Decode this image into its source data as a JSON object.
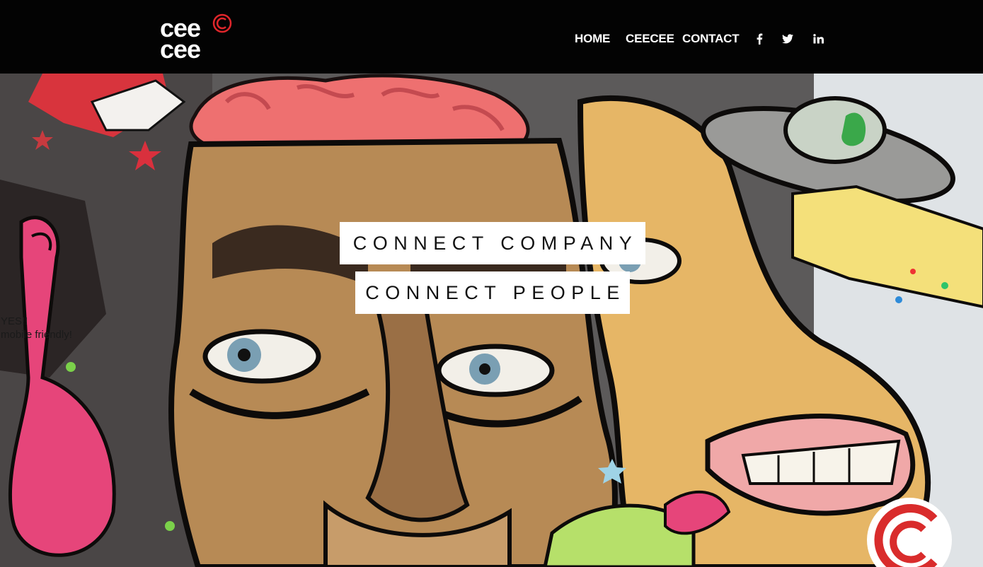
{
  "brand": {
    "logo_line1": "cee",
    "logo_line2": "cee",
    "accent": "#e0262b",
    "header_bg": "#030303"
  },
  "nav": {
    "items": [
      {
        "label": "HOME"
      },
      {
        "label": "CEECEE"
      },
      {
        "label": "CONTACT"
      }
    ],
    "social": [
      {
        "icon": "facebook-icon",
        "glyph": "f"
      },
      {
        "icon": "twitter-icon"
      },
      {
        "icon": "linkedin-icon",
        "glyph": "in"
      }
    ]
  },
  "hero": {
    "tagline1": "CONNECT COMPANY",
    "tagline2": "CONNECT PEOPLE",
    "note_line1": "YES!!",
    "note_line2": "mobile friendly!",
    "image": "graffiti-mural-background"
  }
}
